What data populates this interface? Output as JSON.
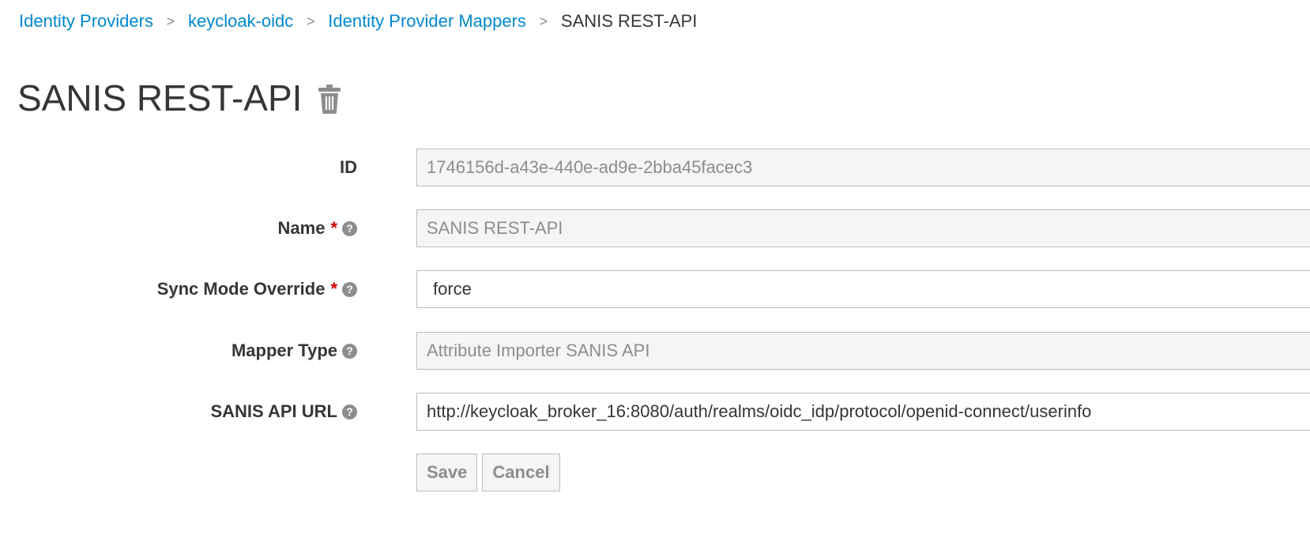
{
  "breadcrumb": {
    "items": [
      {
        "label": "Identity Providers"
      },
      {
        "label": "keycloak-oidc"
      },
      {
        "label": "Identity Provider Mappers"
      }
    ],
    "current": "SANIS REST-API",
    "separator": ">"
  },
  "page": {
    "title": "SANIS REST-API",
    "delete_icon": "trash-icon"
  },
  "form": {
    "id": {
      "label": "ID",
      "value": "1746156d-a43e-440e-ad9e-2bba45facec3"
    },
    "name": {
      "label": "Name",
      "required_mark": "*",
      "value": "SANIS REST-API"
    },
    "sync_mode": {
      "label": "Sync Mode Override",
      "required_mark": "*",
      "value": "force"
    },
    "mapper_type": {
      "label": "Mapper Type",
      "value": "Attribute Importer SANIS API"
    },
    "api_url": {
      "label": "SANIS API URL",
      "value": "http://keycloak_broker_16:8080/auth/realms/oidc_idp/protocol/openid-connect/userinfo"
    },
    "help_glyph": "?"
  },
  "actions": {
    "save_label": "Save",
    "cancel_label": "Cancel"
  },
  "colors": {
    "link": "#0088ce",
    "text": "#363636",
    "required": "#cc0000",
    "muted": "#8b8d8f",
    "readonly_bg": "#f5f5f5",
    "border": "#bbbbbb"
  }
}
